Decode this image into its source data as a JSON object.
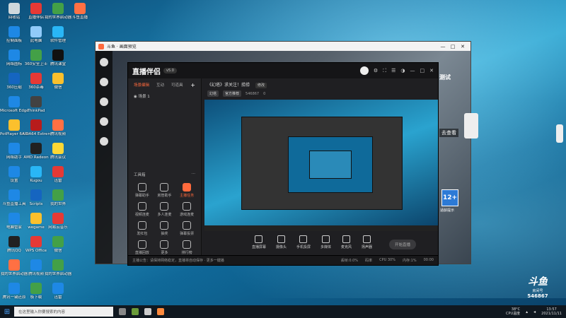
{
  "desktop_icons": [
    {
      "label": "回收站",
      "color": "#cfd8dc",
      "col": 0,
      "row": 0
    },
    {
      "label": "直播伴侣",
      "color": "#e53935",
      "col": 1,
      "row": 0
    },
    {
      "label": "我的世界启动器",
      "color": "#43a047",
      "col": 2,
      "row": 0
    },
    {
      "label": "斗鱼直播",
      "color": "#ff7043",
      "col": 3,
      "row": 0
    },
    {
      "label": "控制面板",
      "color": "#1e88e5",
      "col": 0,
      "row": 1
    },
    {
      "label": "此电脑",
      "color": "#90caf9",
      "col": 1,
      "row": 1
    },
    {
      "label": "软件管理",
      "color": "#29b6f6",
      "col": 2,
      "row": 1
    },
    {
      "label": "网络图标",
      "color": "#1e88e5",
      "col": 0,
      "row": 2
    },
    {
      "label": "360安全卫士",
      "color": "#43a047",
      "col": 1,
      "row": 2
    },
    {
      "label": "腾讯课堂",
      "color": "#111111",
      "col": 2,
      "row": 2
    },
    {
      "label": "360压缩",
      "color": "#1565c0",
      "col": 0,
      "row": 3
    },
    {
      "label": "360杀毒",
      "color": "#e53935",
      "col": 1,
      "row": 3
    },
    {
      "label": "微信",
      "color": "#fbc02d",
      "col": 2,
      "row": 3
    },
    {
      "label": "Microsoft Edge",
      "color": "#1e88e5",
      "col": 0,
      "row": 4
    },
    {
      "label": "ThinkPad",
      "color": "#424242",
      "col": 1,
      "row": 4
    },
    {
      "label": "PotPlayer 64 bit",
      "color": "#fbc02d",
      "col": 0,
      "row": 5
    },
    {
      "label": "AIDA64 Extreme",
      "color": "#b71c1c",
      "col": 1,
      "row": 5
    },
    {
      "label": "腾讯视频",
      "color": "#ff7043",
      "col": 2,
      "row": 5
    },
    {
      "label": "网络助手",
      "color": "#1e88e5",
      "col": 0,
      "row": 6
    },
    {
      "label": "AMD Radeon",
      "color": "#212121",
      "col": 1,
      "row": 6
    },
    {
      "label": "腾讯会议",
      "color": "#fdd835",
      "col": 2,
      "row": 6
    },
    {
      "label": "设置",
      "color": "#1e88e5",
      "col": 0,
      "row": 7
    },
    {
      "label": "Kugou",
      "color": "#29b6f6",
      "col": 1,
      "row": 7
    },
    {
      "label": "迅雷",
      "color": "#e53935",
      "col": 2,
      "row": 7
    },
    {
      "label": "斗鱼直播工具",
      "color": "#1e88e5",
      "col": 0,
      "row": 8
    },
    {
      "label": "Scripts",
      "color": "#1565c0",
      "col": 1,
      "row": 8
    },
    {
      "label": "我的世界",
      "color": "#43a047",
      "col": 2,
      "row": 8
    },
    {
      "label": "电脑管家",
      "color": "#1e88e5",
      "col": 0,
      "row": 9
    },
    {
      "label": "wegame",
      "color": "#fbc02d",
      "col": 1,
      "row": 9
    },
    {
      "label": "网易云音乐",
      "color": "#e53935",
      "col": 2,
      "row": 9
    },
    {
      "label": "腾讯QQ",
      "color": "#212121",
      "col": 0,
      "row": 10
    },
    {
      "label": "WPS Office",
      "color": "#e53935",
      "col": 1,
      "row": 10
    },
    {
      "label": "微信",
      "color": "#43a047",
      "col": 2,
      "row": 10
    },
    {
      "label": "我的世界启动器",
      "color": "#ff7043",
      "col": 0,
      "row": 11
    },
    {
      "label": "腾讯视频",
      "color": "#1e88e5",
      "col": 1,
      "row": 11
    },
    {
      "label": "我的世界启动器",
      "color": "#43a047",
      "col": 2,
      "row": 11
    },
    {
      "label": "腾讯一键还原",
      "color": "#1e88e5",
      "col": 0,
      "row": 12
    },
    {
      "label": "极下载",
      "color": "#43a047",
      "col": 1,
      "row": 12
    },
    {
      "label": "迅雷",
      "color": "#1e88e5",
      "col": 2,
      "row": 12
    }
  ],
  "outer_window": {
    "title": "斗鱼 · 画面预览",
    "controls": [
      "—",
      "□",
      "✕"
    ]
  },
  "app": {
    "logo": "直播伴侣",
    "version": "v5.0",
    "top_icons": [
      "⚙",
      "⛶",
      "☰",
      "◑",
      "—",
      "□",
      "✕"
    ],
    "sidebar": {
      "tabs": [
        "场景编辑",
        "互动",
        "可道具"
      ],
      "add": "+",
      "scene": "场景 1",
      "tools_title": "工具箱",
      "tools_more": "···",
      "tools": [
        {
          "label": "弹幕助手",
          "hot": false
        },
        {
          "label": "房管助手",
          "hot": false
        },
        {
          "label": "主播任务",
          "hot": true
        },
        {
          "label": "视频连麦",
          "hot": false
        },
        {
          "label": "多人连麦",
          "hot": false
        },
        {
          "label": "游戏连麦",
          "hot": false
        },
        {
          "label": "发红包",
          "hot": false
        },
        {
          "label": "抽奖",
          "hot": false
        },
        {
          "label": "弹幕投票",
          "hot": false
        },
        {
          "label": "直播回放",
          "hot": false
        },
        {
          "label": "更多",
          "hot": false
        },
        {
          "label": "排行榜",
          "hot": false
        }
      ]
    },
    "room": {
      "title": "《幻塔》求关注！捞捞",
      "edit": "修改",
      "category": "幻塔",
      "tag": "官方推荐",
      "room_id": "546867",
      "hot": "0"
    },
    "controls": [
      {
        "label": "直播屏幕"
      },
      {
        "label": "摄像头"
      },
      {
        "label": "手机投屏"
      },
      {
        "label": "多媒体"
      },
      {
        "label": "麦克风"
      },
      {
        "label": "扬声器"
      }
    ],
    "go_live": "开始直播",
    "status_text": "主播公告：请保持网络稳定，直播将自动保存 · 更多一键播",
    "status_right": [
      "丢帧:0.0%",
      "码率",
      "CPU 30%",
      "内存:1%",
      "00:00"
    ]
  },
  "game_overlay": {
    "age_badge": "12+",
    "age_tip": "适龄提示",
    "right_text_1": "测试",
    "right_text_2": "去查看"
  },
  "douyu_logo": {
    "brand": "斗鱼",
    "room_label": "房间号",
    "room_number": "546867"
  },
  "taskbar": {
    "start": "⊞",
    "search_placeholder": "在这里输入你要搜索的内容",
    "weather_temp": "38°C",
    "weather_label": "CPU温度",
    "time": "13:57",
    "date": "2021/11/11"
  }
}
